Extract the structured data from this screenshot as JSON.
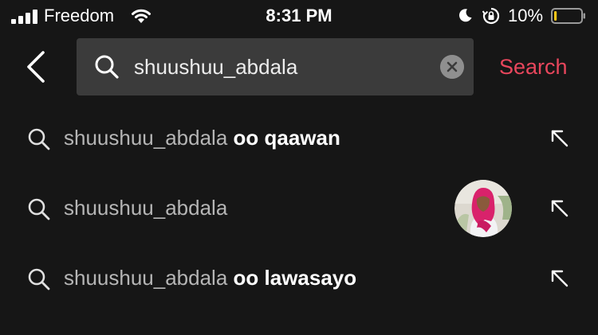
{
  "status_bar": {
    "carrier": "Freedom",
    "time": "8:31 PM",
    "battery_percent": "10%",
    "battery_level": 0.1,
    "battery_color": "#f5c518"
  },
  "header": {
    "back_icon": "chevron-left-icon",
    "search_query": "shuushuu_abdala",
    "search_placeholder": "",
    "clear_icon": "close-circle-icon",
    "search_label": "Search",
    "accent_color": "#e8465c"
  },
  "suggestions": [
    {
      "prefix": "shuushuu_abdala",
      "suffix": " oo qaawan",
      "has_avatar": false
    },
    {
      "prefix": "shuushuu_abdala",
      "suffix": "",
      "has_avatar": true
    },
    {
      "prefix": "shuushuu_abdala",
      "suffix": " oo lawasayo",
      "has_avatar": false
    }
  ]
}
